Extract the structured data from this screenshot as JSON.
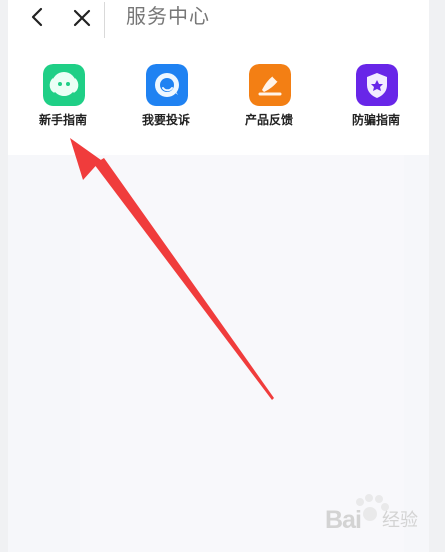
{
  "header": {
    "title": "服务中心",
    "back_icon": "chevron-left-icon",
    "close_icon": "close-icon"
  },
  "services": [
    {
      "label": "新手指南",
      "icon": "newbie-guide-icon",
      "color": "#1fcf86"
    },
    {
      "label": "我要投诉",
      "icon": "complaint-icon",
      "color": "#1f82f2"
    },
    {
      "label": "产品反馈",
      "icon": "feedback-icon",
      "color": "#f37f14"
    },
    {
      "label": "防骗指南",
      "icon": "anti-fraud-guide-icon",
      "color": "#6826e8"
    }
  ],
  "overlay": {
    "annotation": "red-arrow-pointing-to-newbie-guide",
    "arrow_color": "#f03c3c"
  },
  "watermark": {
    "logo_icon": "paw-watermark-icon",
    "brand": "Bai",
    "suffix": "经验"
  }
}
